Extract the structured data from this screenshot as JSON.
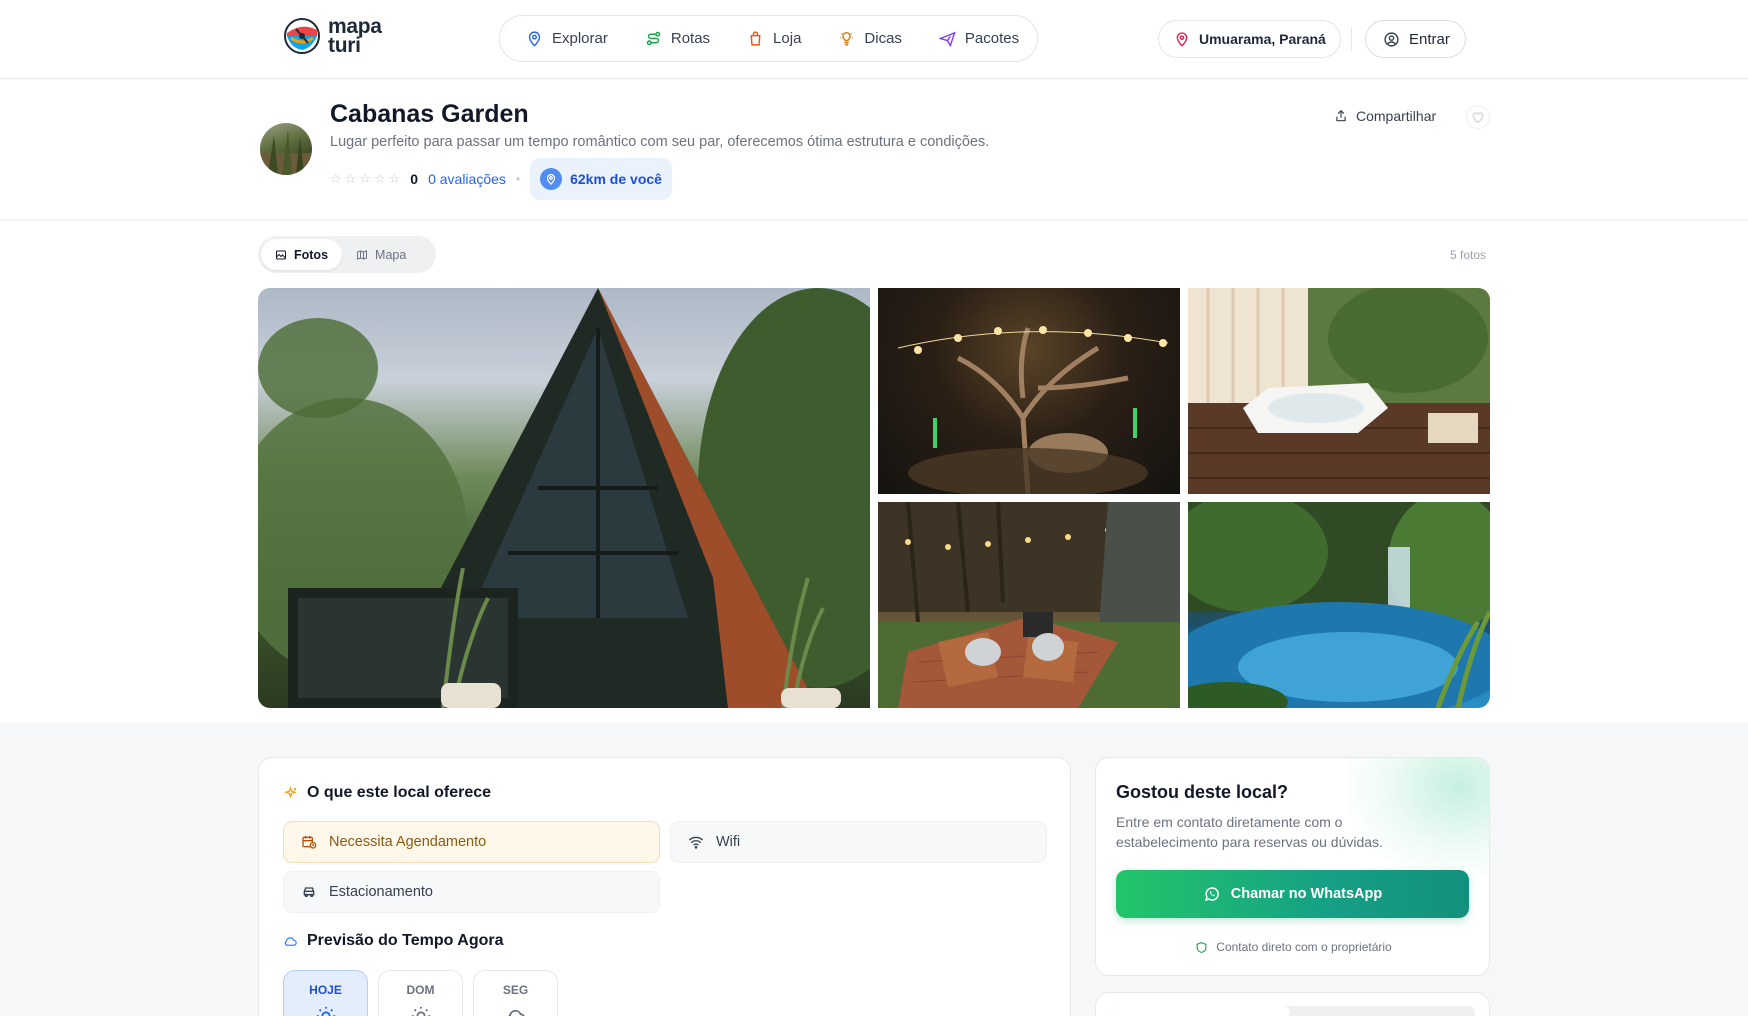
{
  "brand": {
    "line1": "mapa",
    "line2": "turi"
  },
  "nav": [
    {
      "label": "Explorar",
      "icon": "map-pin-icon",
      "color": "#2563eb"
    },
    {
      "label": "Rotas",
      "icon": "route-icon",
      "color": "#16a34a"
    },
    {
      "label": "Loja",
      "icon": "shopping-bag-icon",
      "color": "#ea580c"
    },
    {
      "label": "Dicas",
      "icon": "lightbulb-icon",
      "color": "#d97706"
    },
    {
      "label": "Pacotes",
      "icon": "plane-icon",
      "color": "#7c3aed"
    }
  ],
  "header": {
    "location": "Umuarama, Paraná",
    "login": "Entrar"
  },
  "place": {
    "title": "Cabanas Garden",
    "description": "Lugar perfeito para passar um tempo romântico com seu par, oferecemos ótima estrutura e condições.",
    "rating": "0",
    "rating_stars_filled": 0,
    "reviews": "0 avaliações",
    "distance": "62km de você",
    "share": "Compartilhar"
  },
  "gallery": {
    "tabs": [
      {
        "label": "Fotos",
        "active": true
      },
      {
        "label": "Mapa",
        "active": false
      }
    ],
    "count": "5 fotos",
    "photos": [
      "a-frame-cabin",
      "lit-tree-night",
      "jacuzzi",
      "firepit-chairs",
      "waterfall-pool"
    ]
  },
  "offer": {
    "title": "O que este local oferece",
    "amenities": [
      {
        "label": "Necessita Agendamento",
        "icon": "calendar-clock-icon",
        "highlight": true
      },
      {
        "label": "Wifi",
        "icon": "wifi-icon",
        "highlight": false
      },
      {
        "label": "Estacionamento",
        "icon": "car-icon",
        "highlight": false
      }
    ],
    "weather_title": "Previsão do Tempo Agora",
    "days": [
      {
        "label": "HOJE",
        "active": true
      },
      {
        "label": "DOM",
        "active": false
      },
      {
        "label": "SEG",
        "active": false
      }
    ]
  },
  "contact": {
    "title": "Gostou deste local?",
    "description": "Entre em contato diretamente com o estabelecimento para reservas ou dúvidas.",
    "button": "Chamar no WhatsApp",
    "note": "Contato direto com o proprietário"
  },
  "colors": {
    "accent_blue": "#2563eb",
    "whatsapp": "#22c56a",
    "warn_bg": "#fff8ea"
  }
}
